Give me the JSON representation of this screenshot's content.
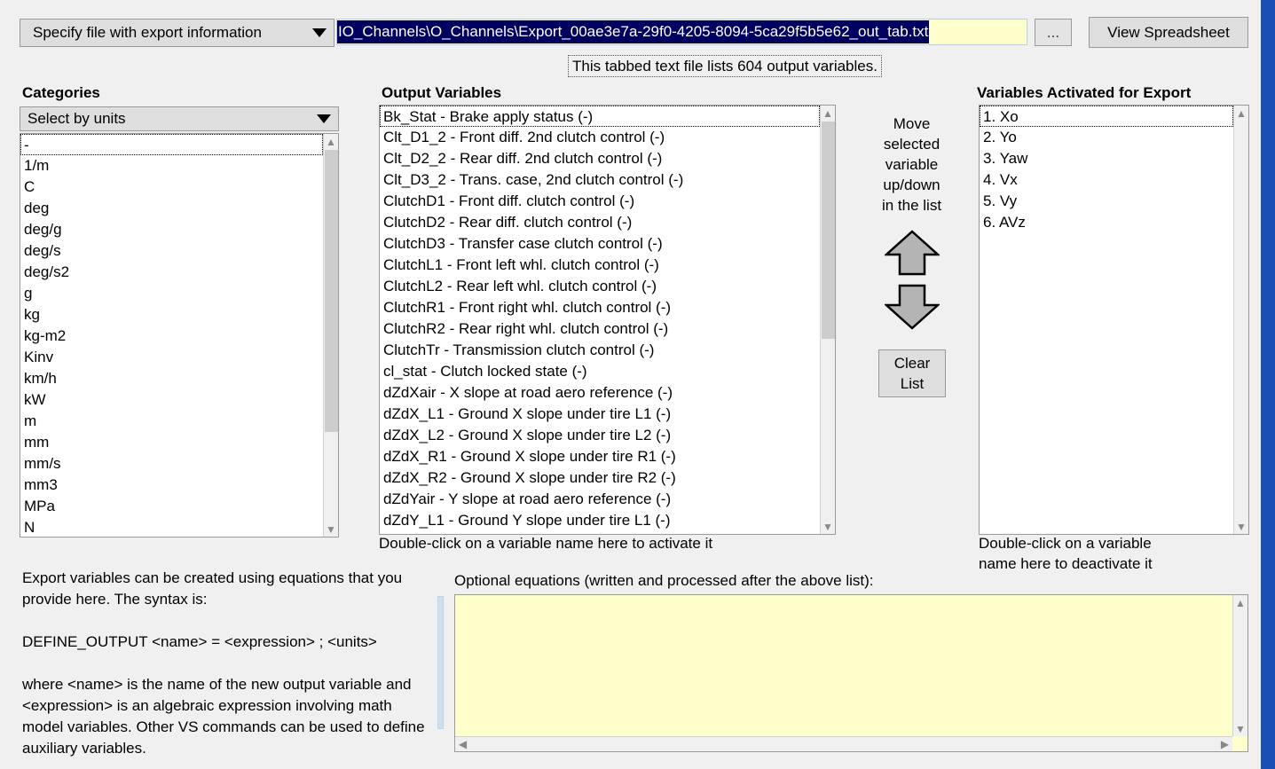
{
  "window": {
    "background": "#f0f0f0",
    "border_color": "#1a4fb4"
  },
  "toolbar": {
    "mode_combo_label": "Specify file with export information",
    "mode_combo_caret": "chevron-down-icon",
    "path_value": "IO_Channels\\O_Channels\\Export_00ae3e7a-29f0-4205-8094-5ca29f5b5e62_out_tab.txt",
    "path_field_bg": "#ffffcc",
    "path_selection_bg": "#000060",
    "browse_label": "...",
    "view_spreadsheet_label": "View Spreadsheet",
    "tooltip": "This tabbed text file lists 604 output variables."
  },
  "categories": {
    "heading": "Categories",
    "select_label": "Select by units",
    "units": [
      "-",
      "1/m",
      "C",
      "deg",
      "deg/g",
      "deg/s",
      "deg/s2",
      "g",
      "kg",
      "kg-m2",
      "Kinv",
      "km/h",
      "kW",
      "m",
      "mm",
      "mm/s",
      "mm3",
      "MPa",
      "N"
    ],
    "focused_index": 0
  },
  "output_variables": {
    "heading": "Output Variables",
    "items": [
      "Bk_Stat - Brake apply status (-)",
      "Clt_D1_2 - Front diff. 2nd clutch control (-)",
      "Clt_D2_2 - Rear diff. 2nd clutch control (-)",
      "Clt_D3_2 - Trans. case, 2nd clutch control (-)",
      "ClutchD1 - Front diff. clutch control (-)",
      "ClutchD2 - Rear diff. clutch control (-)",
      "ClutchD3 - Transfer case clutch control (-)",
      "ClutchL1 - Front left whl. clutch control (-)",
      "ClutchL2 - Rear left whl. clutch control (-)",
      "ClutchR1 - Front right whl. clutch control (-)",
      "ClutchR2 - Rear right whl. clutch control (-)",
      "ClutchTr - Transmission clutch control (-)",
      "cl_stat - Clutch locked state (-)",
      "dZdXair - X slope at road aero reference (-)",
      "dZdX_L1 - Ground X slope under tire L1 (-)",
      "dZdX_L2 - Ground X slope under tire L2 (-)",
      "dZdX_R1 - Ground X slope under tire R1 (-)",
      "dZdX_R2 - Ground X slope under tire R2 (-)",
      "dZdYair - Y slope at road aero reference (-)",
      "dZdY_L1 - Ground Y slope under tire L1 (-)"
    ],
    "focused_index": 0,
    "hint": "Double-click on a variable name here to activate it"
  },
  "move_panel": {
    "instruction_lines": [
      "Move",
      "selected",
      "variable",
      "up/down",
      "in the list"
    ],
    "up_arrow_icon": "arrow-up-icon",
    "down_arrow_icon": "arrow-down-icon",
    "arrow_fill": "#b4b4b4",
    "clear_list_line1": "Clear",
    "clear_list_line2": "List"
  },
  "activated": {
    "heading": "Variables Activated for Export",
    "items": [
      "1. Xo",
      "2. Yo",
      "3. Yaw",
      "4. Vx",
      "5. Vy",
      "6. AVz"
    ],
    "focused_index": 0,
    "hint_line1": "Double-click on a variable",
    "hint_line2": "name here to deactivate it"
  },
  "help": {
    "paragraph1": "Export variables can be created using equations that you provide here. The syntax is:",
    "paragraph2": "DEFINE_OUTPUT <name> = <expression> ; <units>",
    "paragraph3": "where <name> is the name of the new output variable and <expression> is an algebraic expression involving math model variables. Other VS commands can be used to define auxiliary variables."
  },
  "equations": {
    "label": "Optional equations (written and processed after the above list):",
    "value": "",
    "background": "#ffffcc"
  },
  "icons": {
    "scroll_up": "⌃",
    "scroll_down": "⌄",
    "scroll_left": "‹",
    "scroll_right": "›"
  }
}
